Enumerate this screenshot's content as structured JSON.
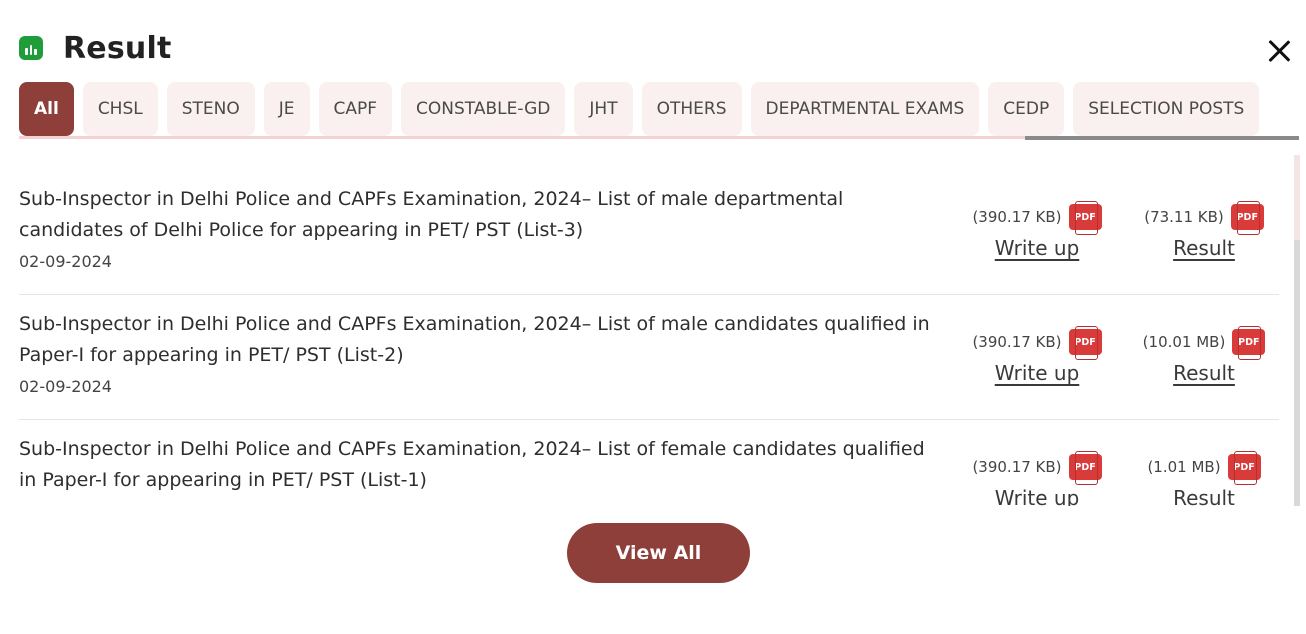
{
  "header": {
    "title": "Result",
    "icon": "bar-chart-icon",
    "icon_color": "#1f9d3a"
  },
  "close_icon": "close-icon",
  "tabs": [
    "All",
    "CHSL",
    "STENO",
    "JE",
    "CAPF",
    "CONSTABLE-GD",
    "JHT",
    "OTHERS",
    "DEPARTMENTAL EXAMS",
    "CEDP",
    "SELECTION POSTS"
  ],
  "active_tab": "All",
  "accent_color": "#8f3f3a",
  "items": [
    {
      "title": "Sub-Inspector in Delhi Police and CAPFs Examination, 2024– List of male departmental candidates of Delhi Police for appearing in PET/ PST (List-3)",
      "date": "02-09-2024",
      "writeup": {
        "size": "(390.17 KB)",
        "badge": "PDF",
        "label": "Write up"
      },
      "result": {
        "size": "(73.11 KB)",
        "badge": "PDF",
        "label": "Result"
      }
    },
    {
      "title": "Sub-Inspector in Delhi Police and CAPFs Examination, 2024– List of male candidates qualified in Paper-I for appearing in PET/ PST (List-2)",
      "date": "02-09-2024",
      "writeup": {
        "size": "(390.17 KB)",
        "badge": "PDF",
        "label": "Write up"
      },
      "result": {
        "size": "(10.01 MB)",
        "badge": "PDF",
        "label": "Result"
      }
    },
    {
      "title": "Sub-Inspector in Delhi Police and CAPFs Examination, 2024– List of female candidates qualified in Paper-I for appearing in PET/ PST (List-1)",
      "date": "",
      "writeup": {
        "size": "(390.17 KB)",
        "badge": "PDF",
        "label": "Write up"
      },
      "result": {
        "size": "(1.01 MB)",
        "badge": "PDF",
        "label": "Result"
      }
    }
  ],
  "view_all_label": "View All"
}
